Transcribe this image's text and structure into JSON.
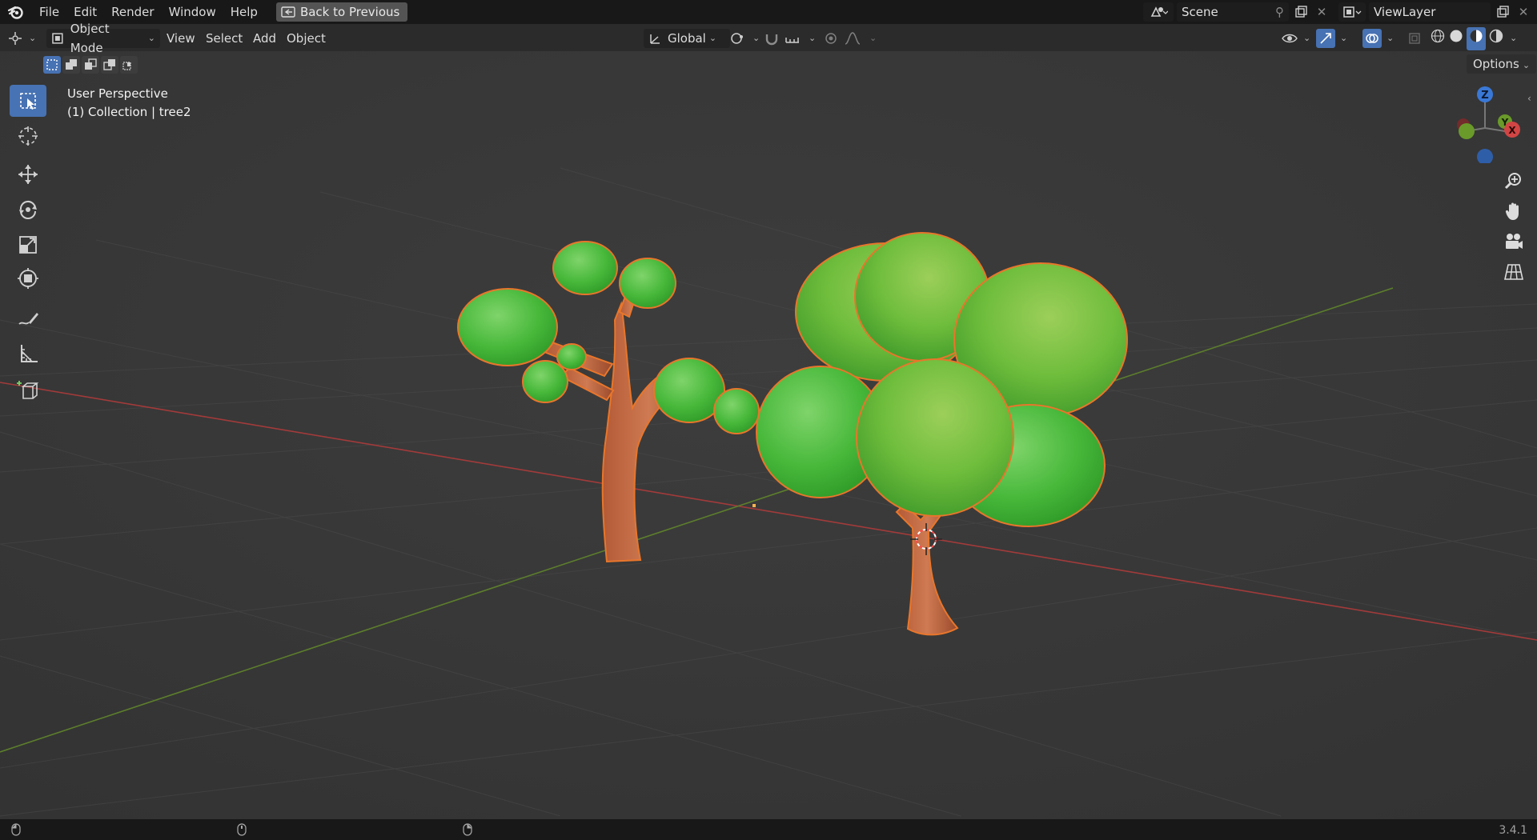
{
  "menu": {
    "items": [
      "File",
      "Edit",
      "Render",
      "Window",
      "Help"
    ],
    "back_label": "Back to Previous"
  },
  "scene": {
    "name": "Scene",
    "view_layer": "ViewLayer"
  },
  "header": {
    "mode": "Object Mode",
    "menus": [
      "View",
      "Select",
      "Add",
      "Object"
    ],
    "transform_orientation": "Global",
    "options_label": "Options"
  },
  "viewport": {
    "perspective_label": "User Perspective",
    "collection_label": "(1) Collection | tree2"
  },
  "toolbar": {
    "tools": [
      "select-box",
      "cursor",
      "move",
      "rotate",
      "scale",
      "transform",
      "annotate",
      "measure",
      "add-cube"
    ],
    "active": "select-box"
  },
  "gizmo": {
    "axes": [
      "Z",
      "Y",
      "X"
    ]
  },
  "colors": {
    "accent": "#4772b3",
    "selection_outline": "#e8762b",
    "x_axis": "#c63b3b",
    "y_axis": "#6a9a2a",
    "z_axis": "#3a78d6"
  },
  "status": {
    "version": "3.4.1"
  }
}
